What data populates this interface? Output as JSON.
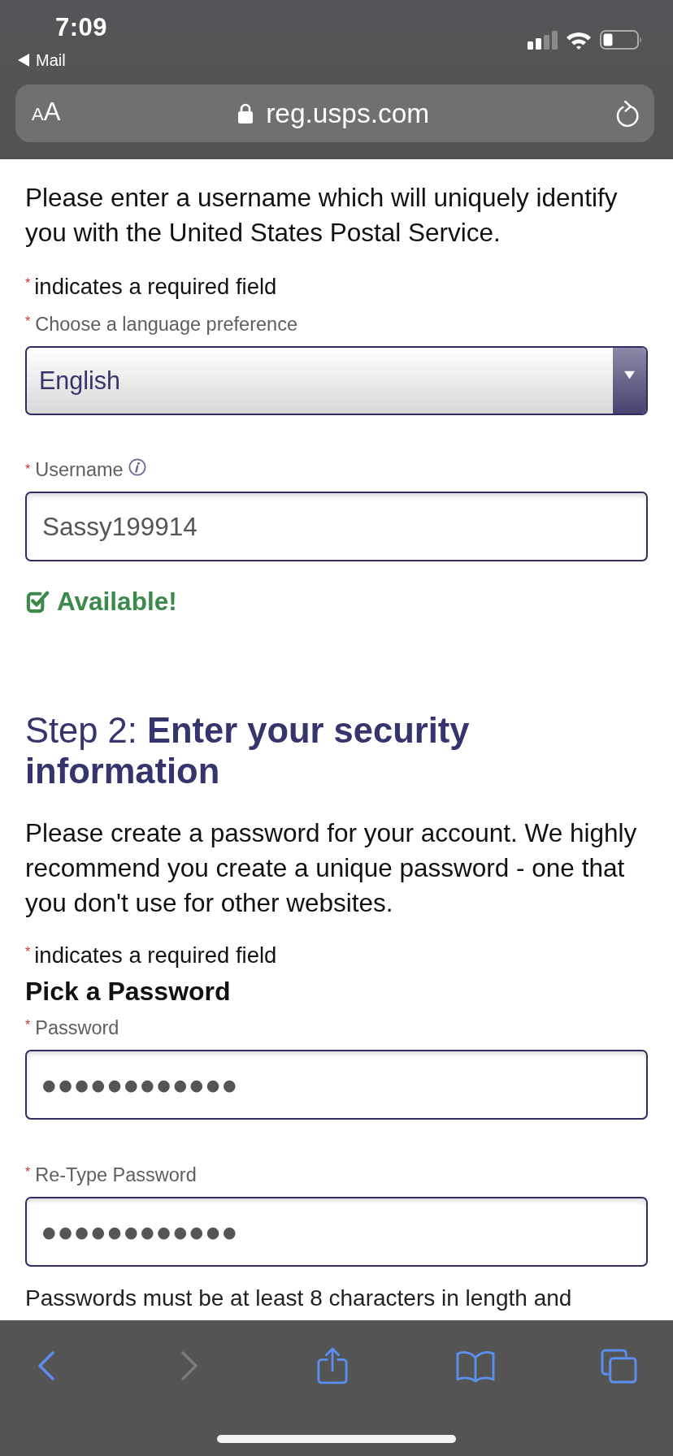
{
  "status_bar": {
    "time": "7:09",
    "back_app": "Mail"
  },
  "address_bar": {
    "text_size_button": "AA",
    "secure": true,
    "url": "reg.usps.com"
  },
  "step1": {
    "intro": "Please enter a username which will uniquely identify you with the United States Postal Service.",
    "required_note": {
      "mark": "*",
      "text": "indicates a required field"
    },
    "language": {
      "mark": "*",
      "label": "Choose a language preference",
      "value": "English"
    },
    "username": {
      "mark": "*",
      "label": "Username",
      "info": true,
      "value": "Sassy199914",
      "status": {
        "kind": "available",
        "text": "Available!"
      }
    }
  },
  "step2": {
    "heading": "Step 2: **Enter your security information**",
    "intro": "Please create a password for your account. We highly recommend you create a unique password - one that you don't use for other websites.",
    "required_note": {
      "mark": "*",
      "text": "indicates a required field"
    },
    "subheading": "Pick a Password",
    "fields": [
      {
        "mark": "*",
        "label": "Password",
        "value": "●●●●●●●●●●●●"
      },
      {
        "mark": "*",
        "label": "Re-Type Password",
        "value": "●●●●●●●●●●●●"
      }
    ],
    "note": "Passwords must be at least 8 characters in length and"
  },
  "toolbar": {
    "buttons": [
      {
        "kind": "back",
        "disabled": false
      },
      {
        "kind": "forward",
        "disabled": true
      },
      {
        "kind": "share",
        "disabled": false
      },
      {
        "kind": "bookmarks",
        "disabled": false
      },
      {
        "kind": "tabs",
        "disabled": false
      }
    ]
  }
}
